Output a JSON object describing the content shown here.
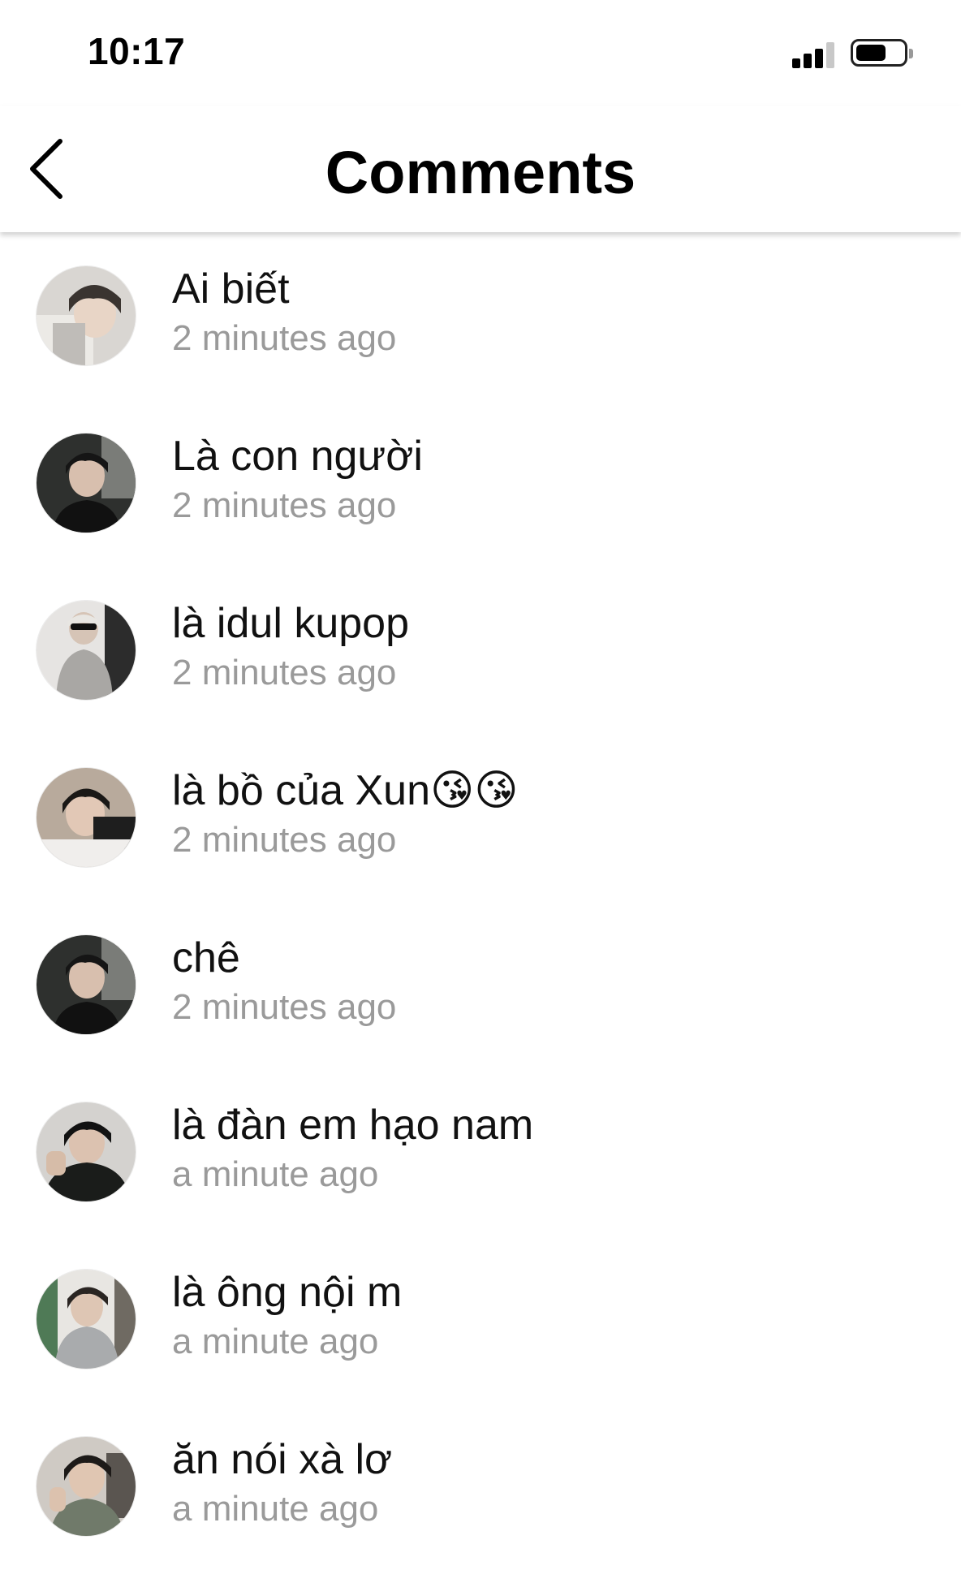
{
  "status_bar": {
    "time": "10:17"
  },
  "header": {
    "title": "Comments",
    "back_icon": "chevron-left-icon"
  },
  "comments": [
    {
      "text": "Ai biết",
      "time": "2 minutes ago"
    },
    {
      "text": "Là con người",
      "time": "2 minutes ago"
    },
    {
      "text": "là idul kupop",
      "time": "2 minutes ago"
    },
    {
      "text": "là bồ của Xun😘😘",
      "time": "2 minutes ago"
    },
    {
      "text": "chê",
      "time": "2 minutes ago"
    },
    {
      "text": "là đàn em hạo nam",
      "time": "a minute ago"
    },
    {
      "text": "là ông nội m",
      "time": "a minute ago"
    },
    {
      "text": "ăn nói xà lơ",
      "time": "a minute ago"
    }
  ],
  "colors": {
    "timestamp": "#9a9a9a",
    "title": "#000000"
  }
}
